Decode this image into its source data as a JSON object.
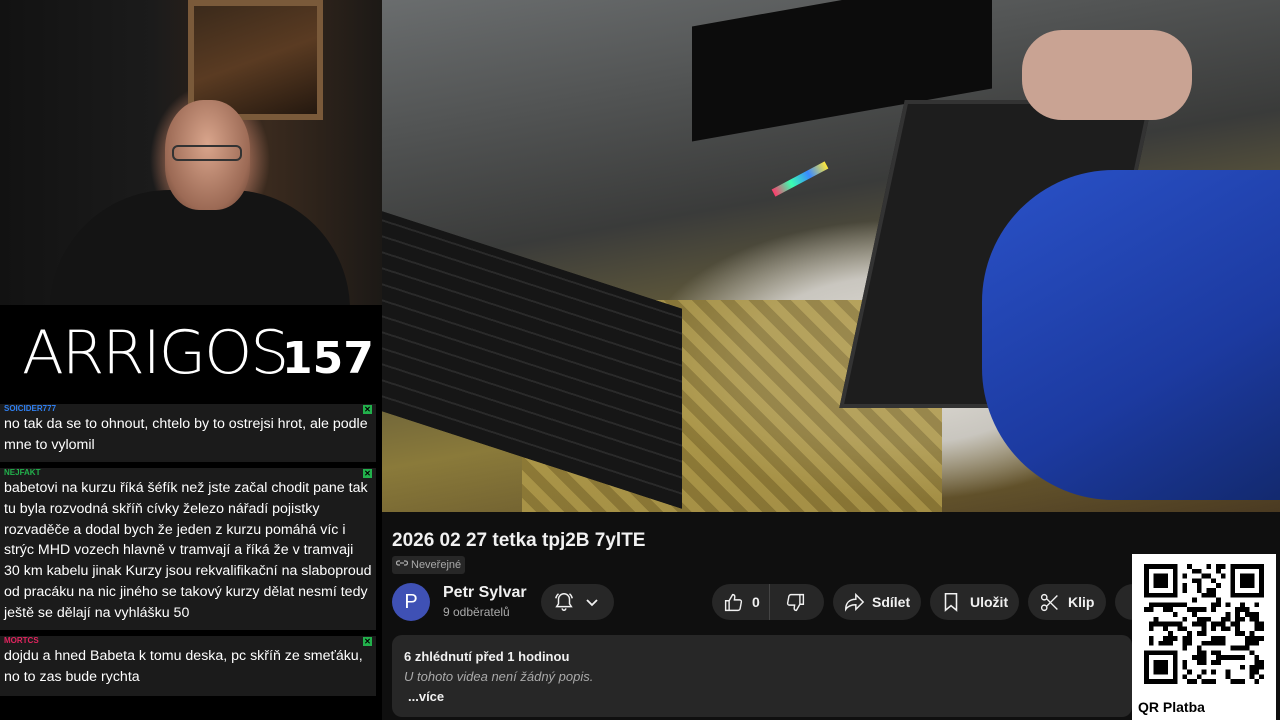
{
  "stream": {
    "logo_text": "ARRIGOS",
    "logo_number": "157"
  },
  "chat": {
    "messages": [
      {
        "user": "SOICIDER777",
        "user_color": "#2f7ff0",
        "text": "no tak da se to ohnout, chtelo by to ostrejsi hrot, ale podle mne to vylomil"
      },
      {
        "user": "NEJFAKT",
        "user_color": "#22b14c",
        "text": "babetovi na kurzu říká šéfík než jste začal chodit pane tak tu byla rozvodná skříň cívky železo nářadí pojistky rozvaděče a dodal bych že jeden z kurzu pomáhá víc i strýc MHD vozech hlavně v tramvají a říká že v tramvaji 30 km kabelu jinak Kurzy jsou rekvalifikační na slaboproud od pracáku na nic jiného se takový kurzy dělat nesmí tedy ještě se dělají na vyhlášku 50"
      },
      {
        "user": "MORTCS",
        "user_color": "#e0245e",
        "text": "dojdu a hned Babeta k tomu deska, pc skříň ze smeťáku, no to zas bude rychta"
      }
    ]
  },
  "video": {
    "title": "2026 02 27 tetka tpj2B 7ylTE",
    "visibility": "Neveřejné",
    "channel": {
      "avatar_letter": "P",
      "name": "Petr Sylvar",
      "subscribers": "9 odběratelů"
    },
    "actions": {
      "like_count": "0",
      "share_label": "Sdílet",
      "save_label": "Uložit",
      "clip_label": "Klip"
    },
    "description": {
      "meta": "6 zhlédnutí  před 1 hodinou",
      "empty_text": "U tohoto videa není žádný popis.",
      "more_label": "...více"
    }
  },
  "qr": {
    "label": "QR Platba"
  }
}
